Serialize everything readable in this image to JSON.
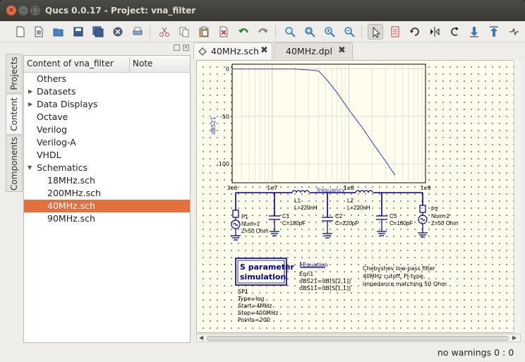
{
  "window": {
    "title": "Qucs 0.0.17 - Project: vna_filter"
  },
  "dock": {
    "vertical_tabs": [
      "Projects",
      "Content",
      "Components"
    ],
    "tree_headers": [
      "Content of vna_filter",
      "Note"
    ],
    "tree_items": [
      {
        "label": "Others"
      },
      {
        "label": "Datasets"
      },
      {
        "label": "Data Displays"
      },
      {
        "label": "Octave"
      },
      {
        "label": "Verilog"
      },
      {
        "label": "Verilog-A"
      },
      {
        "label": "VHDL"
      },
      {
        "label": "Schematics"
      },
      {
        "label": "18MHz.sch"
      },
      {
        "label": "200MHz.sch"
      },
      {
        "label": "40MHz.sch"
      },
      {
        "label": "90MHz.sch"
      }
    ]
  },
  "tabs": [
    {
      "label": "40MHz.sch",
      "close": "✖"
    },
    {
      "label": "40MHz.dpl",
      "close": "✖"
    }
  ],
  "diagram": {
    "ylabel": "dBS21",
    "y_ticks": [
      "0",
      "-50",
      "-100"
    ],
    "x_ticks": [
      "3e6",
      "1e7",
      "1e8",
      "1e9"
    ],
    "xlabel": "frequency",
    "trace_color": "#3333cc",
    "chart_data": {
      "type": "line",
      "xscale": "log",
      "xlim": [
        3000000,
        1000000000
      ],
      "ylim": [
        -120,
        5
      ],
      "ylabel": "dBS21",
      "xlabel": "frequency",
      "x": [
        3000000,
        10000000,
        20000000,
        30000000,
        40000000,
        50000000,
        70000000,
        100000000,
        150000000,
        200000000,
        300000000,
        400000000
      ],
      "y": [
        0,
        0,
        0,
        -1,
        -2,
        -10,
        -25,
        -43,
        -62,
        -77,
        -97,
        -112
      ]
    }
  },
  "schematic": {
    "P1": {
      "name": "P1",
      "num": "Num=1",
      "z": "Z=50 Ohm"
    },
    "P2": {
      "name": "P2",
      "num": "Num=2",
      "z": "Z=50 Ohm"
    },
    "L1": {
      "name": "L1",
      "value": "L=220nH"
    },
    "L2": {
      "name": "L2",
      "value": "L=220nH"
    },
    "C1": {
      "name": "C1",
      "value": "C=180pF"
    },
    "C2": {
      "name": "C2",
      "value": "C=220pF"
    },
    "C3": {
      "name": "C3",
      "value": "C=180pF"
    },
    "sim": {
      "box_line1": "S parameter",
      "box_line2": "simulation",
      "name": "SP1",
      "type": "Type=log",
      "start": "Start=4MHz",
      "stop": "Stop=400MHz",
      "points": "Points=200"
    },
    "eqn": {
      "title": "Equation",
      "name": "Eqn1",
      "line1": "dBS21=dB(S[2,1])",
      "line2": "dBS11=dB(S[1,1])"
    },
    "note": {
      "line1": "Chebyshev low-pass filter",
      "line2": "40MHz cutoff, PI-type,",
      "line3": "impedance matching 50 Ohm"
    },
    "wire_color": "#000080",
    "label_color": "#000000"
  },
  "status": {
    "text": "no warnings   0 : 0"
  }
}
